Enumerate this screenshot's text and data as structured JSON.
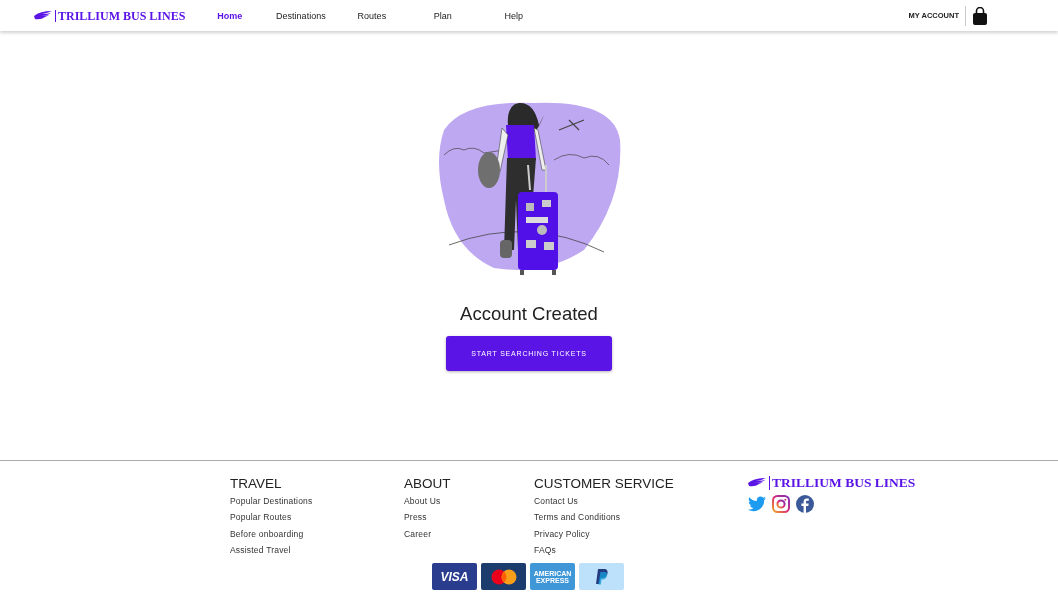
{
  "header": {
    "logo": "TRILLIUM BUS LINES",
    "nav": [
      {
        "label": "Home",
        "selected": true
      },
      {
        "label": "Destinations",
        "selected": false
      },
      {
        "label": "Routes",
        "selected": false
      },
      {
        "label": "Plan",
        "selected": false
      },
      {
        "label": "Help",
        "selected": false
      }
    ],
    "account": "MY ACCOUNT"
  },
  "main": {
    "title": "Account Created",
    "button": "START SEARCHING TICKETS"
  },
  "footer": {
    "columns": [
      {
        "heading": "TRAVEL",
        "links": [
          "Popular Destinations",
          "Popular Routes",
          "Before onboarding",
          "Assisted Travel"
        ]
      },
      {
        "heading": "ABOUT",
        "links": [
          "About Us",
          "Press",
          "Career"
        ]
      },
      {
        "heading": "CUSTOMER SERVICE",
        "links": [
          "Contact Us",
          "Terms and Conditions",
          "Privacy Policy",
          "FAQs"
        ]
      }
    ],
    "logo": "TRILLIUM BUS LINES",
    "social": [
      {
        "kind": "twitter"
      },
      {
        "kind": "instagram"
      },
      {
        "kind": "facebook"
      }
    ],
    "payments": [
      {
        "kind": "visa",
        "text": "VISA"
      },
      {
        "kind": "mastercard"
      },
      {
        "kind": "amex",
        "text": "AMERICAN EXPRESS"
      },
      {
        "kind": "paypal"
      }
    ]
  }
}
